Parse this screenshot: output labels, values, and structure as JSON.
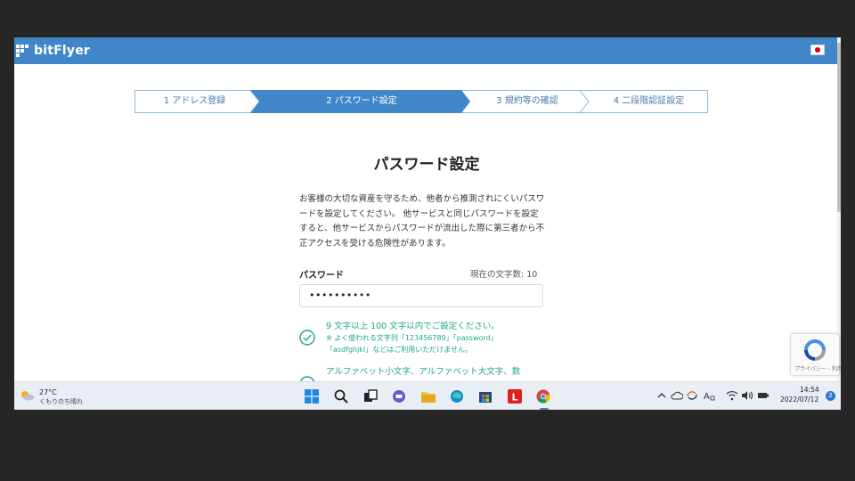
{
  "app": {
    "logo_text": "bitFlyer",
    "flag_icon": "japan-flag-icon"
  },
  "steps": [
    {
      "label": "1 アドレス登録",
      "state": "done"
    },
    {
      "label": "2 パスワード設定",
      "state": "active"
    },
    {
      "label": "3 規約等の確認",
      "state": "todo"
    },
    {
      "label": "4 二段階認証設定",
      "state": "todo"
    }
  ],
  "main": {
    "title": "パスワード設定",
    "intro": "お客様の大切な資産を守るため、他者から推測されにくいパスワードを設定してください。 他サービスと同じパスワードを設定すると、他サービスからパスワードが流出した際に第三者から不正アクセスを受ける危険性があります。",
    "password_label": "パスワード",
    "char_count": "現在の文字数: 10",
    "password_value": "••••••••••",
    "rules": [
      {
        "title": "9 文字以上 100 文字以内でご設定ください。",
        "note1": "※ よく使われる文字列「123456789」「password」",
        "note2": "「asdfghjkl」などはご利用いただけません。",
        "icon": "check-circle-icon"
      },
      {
        "title": "アルファベット小文字、アルファベット大文字、数",
        "icon": "check-circle-icon"
      }
    ]
  },
  "recaptcha": {
    "text": "プライバシー - 利用規約"
  },
  "taskbar": {
    "weather_temp": "27°C",
    "weather_cond": "くもりのち晴れ",
    "apps": [
      "windows-start-icon",
      "search-icon",
      "task-view-icon",
      "chat-icon",
      "file-explorer-icon",
      "edge-icon",
      "store-icon",
      "l-app-icon",
      "chrome-icon"
    ],
    "time": "14:54",
    "date": "2022/07/12",
    "notifications": "2"
  },
  "colors": {
    "brand": "#4186c9",
    "success": "#1fa58a",
    "step_active": "#3f87c8"
  }
}
